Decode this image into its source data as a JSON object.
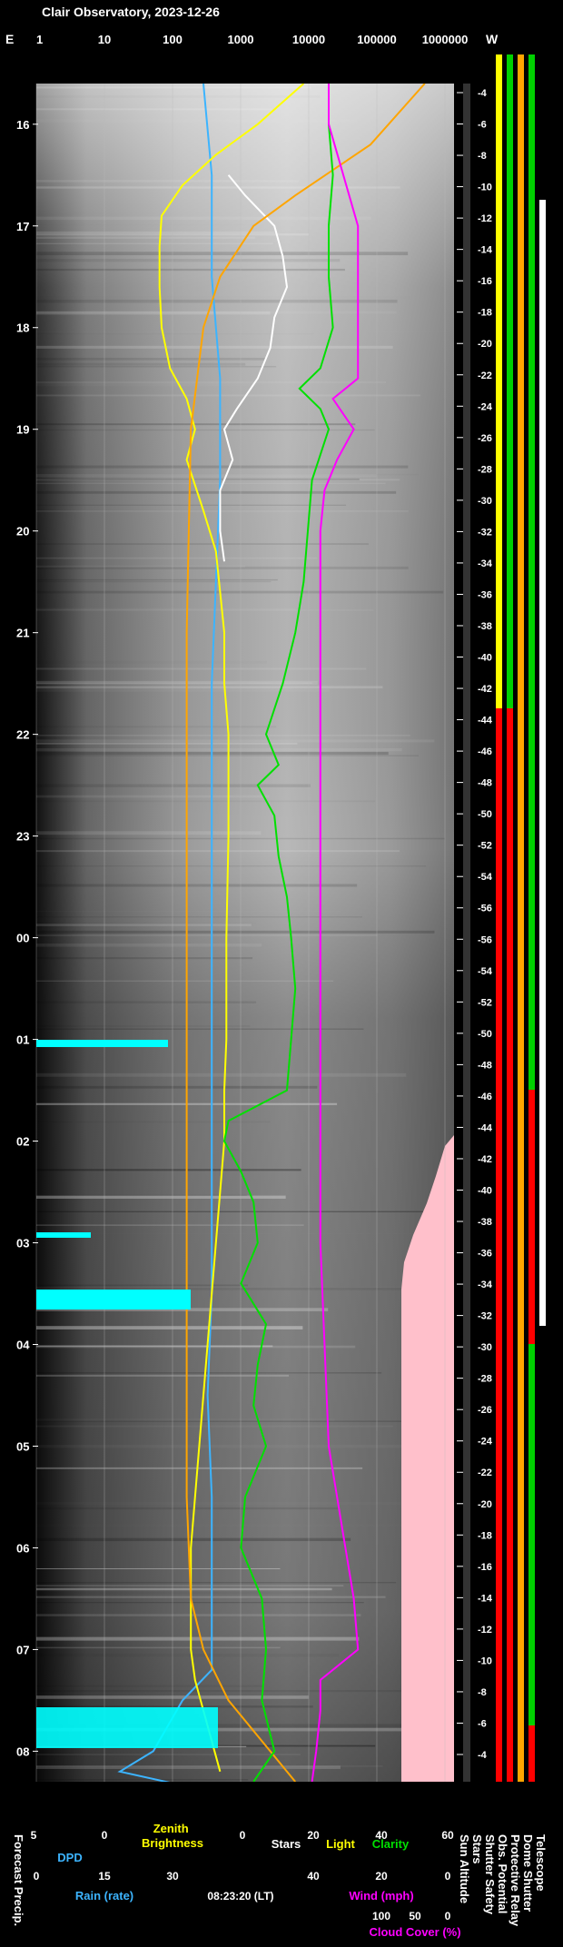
{
  "title": "Clair Observatory, 2023-12-26",
  "timestamp": "08:23:20 (LT)",
  "chart_data": {
    "type": "line",
    "title": "Clair Observatory, 2023-12-26",
    "top_axis": {
      "left_label": "E",
      "right_label": "W",
      "scale": "log",
      "ticks": [
        "1",
        "10",
        "100",
        "1000",
        "10000",
        "100000",
        "1000000"
      ]
    },
    "time_axis": {
      "labels": [
        "16",
        "17",
        "18",
        "19",
        "20",
        "21",
        "22",
        "23",
        "00",
        "01",
        "02",
        "03",
        "04",
        "05",
        "06",
        "07",
        "08"
      ]
    },
    "sun_altitude_labels": [
      "-4",
      "-6",
      "-8",
      "-10",
      "-12",
      "-14",
      "-16",
      "-18",
      "-20",
      "-22",
      "-24",
      "-26",
      "-28",
      "-30",
      "-32",
      "-34",
      "-36",
      "-38",
      "-40",
      "-42",
      "-44",
      "-46",
      "-48",
      "-50",
      "-52",
      "-54",
      "-56",
      "-56",
      "-54",
      "-52",
      "-50",
      "-48",
      "-46",
      "-44",
      "-42",
      "-40",
      "-38",
      "-36",
      "-34",
      "-32",
      "-30",
      "-28",
      "-26",
      "-24",
      "-22",
      "-20",
      "-18",
      "-16",
      "-14",
      "-12",
      "-10",
      "-8",
      "-6",
      "-4"
    ],
    "bottom_axes": {
      "dpd": {
        "label": "DPD",
        "ticks": [
          "5",
          "0"
        ]
      },
      "zenith": {
        "label": "Zenith Brightness",
        "ticks": [
          "0"
        ]
      },
      "stars": {
        "label": "Stars",
        "ticks": [
          "20"
        ]
      },
      "light": {
        "label": "Light",
        "ticks": []
      },
      "clarity": {
        "label": "Clarity",
        "ticks": [
          "40",
          "60"
        ]
      },
      "rain": {
        "label": "Rain (rate)",
        "ticks": [
          "0",
          "15",
          "30"
        ]
      },
      "wind": {
        "label": "Wind (mph)",
        "ticks": [
          "40",
          "20",
          "0"
        ]
      },
      "cloud": {
        "label": "Cloud Cover (%)",
        "ticks": [
          "100",
          "50",
          "0"
        ]
      }
    },
    "left_label": "Forecast Precip.",
    "right_column_labels": [
      "Sun Altitude",
      "Stars",
      "Shutter Safety",
      "Obs. Potential",
      "Protective Relay",
      "Dome Shutter",
      "Telescope"
    ],
    "series": [
      {
        "name": "DPD",
        "color": "#3cb4ff",
        "points": [
          [
            15.6,
            0.4
          ],
          [
            16.5,
            0.42
          ],
          [
            17.5,
            0.42
          ],
          [
            18.5,
            0.44
          ],
          [
            19.5,
            0.44
          ],
          [
            20.5,
            0.43
          ],
          [
            21.5,
            0.42
          ],
          [
            22.5,
            0.42
          ],
          [
            23.5,
            0.42
          ],
          [
            24.5,
            0.42
          ],
          [
            25.5,
            0.42
          ],
          [
            26.5,
            0.42
          ],
          [
            27.5,
            0.42
          ],
          [
            28.5,
            0.41
          ],
          [
            29.5,
            0.42
          ],
          [
            30.5,
            0.42
          ],
          [
            31.2,
            0.42
          ],
          [
            31.5,
            0.35
          ],
          [
            32.0,
            0.28
          ],
          [
            32.2,
            0.2
          ],
          [
            32.4,
            0.42
          ]
        ]
      },
      {
        "name": "Zenith Brightness",
        "color": "#ffff00",
        "points": [
          [
            15.6,
            0.64
          ],
          [
            16.0,
            0.53
          ],
          [
            16.3,
            0.43
          ],
          [
            16.6,
            0.35
          ],
          [
            16.9,
            0.3
          ],
          [
            17.2,
            0.295
          ],
          [
            17.6,
            0.295
          ],
          [
            18.0,
            0.3
          ],
          [
            18.4,
            0.32
          ],
          [
            18.7,
            0.36
          ],
          [
            19.0,
            0.38
          ],
          [
            19.3,
            0.36
          ],
          [
            19.8,
            0.4
          ],
          [
            20.2,
            0.43
          ],
          [
            20.6,
            0.44
          ],
          [
            21.0,
            0.45
          ],
          [
            21.5,
            0.45
          ],
          [
            22.0,
            0.46
          ],
          [
            22.5,
            0.46
          ],
          [
            23.0,
            0.46
          ],
          [
            24.0,
            0.455
          ],
          [
            25.0,
            0.455
          ],
          [
            25.5,
            0.45
          ],
          [
            26.0,
            0.45
          ],
          [
            26.5,
            0.44
          ],
          [
            27.0,
            0.43
          ],
          [
            27.5,
            0.42
          ],
          [
            28.0,
            0.41
          ],
          [
            28.5,
            0.4
          ],
          [
            29.0,
            0.39
          ],
          [
            29.5,
            0.38
          ],
          [
            30.0,
            0.37
          ],
          [
            30.5,
            0.37
          ],
          [
            31.0,
            0.37
          ],
          [
            31.3,
            0.38
          ],
          [
            31.6,
            0.4
          ],
          [
            31.9,
            0.42
          ],
          [
            32.2,
            0.44
          ]
        ]
      },
      {
        "name": "Stars",
        "color": "#ffffff",
        "points": [
          [
            16.5,
            0.46
          ],
          [
            16.7,
            0.5
          ],
          [
            17.0,
            0.57
          ],
          [
            17.3,
            0.59
          ],
          [
            17.6,
            0.6
          ],
          [
            17.9,
            0.57
          ],
          [
            18.2,
            0.56
          ],
          [
            18.5,
            0.53
          ],
          [
            18.8,
            0.48
          ],
          [
            19.0,
            0.45
          ],
          [
            19.3,
            0.47
          ],
          [
            19.6,
            0.44
          ],
          [
            20.0,
            0.44
          ],
          [
            20.3,
            0.45
          ]
        ]
      },
      {
        "name": "Light",
        "color": "#ffa500",
        "points": [
          [
            15.6,
            0.93
          ],
          [
            16.2,
            0.8
          ],
          [
            16.7,
            0.62
          ],
          [
            17.0,
            0.52
          ],
          [
            17.5,
            0.44
          ],
          [
            18.0,
            0.4
          ],
          [
            19.0,
            0.37
          ],
          [
            20.0,
            0.365
          ],
          [
            21.0,
            0.36
          ],
          [
            22.0,
            0.36
          ],
          [
            24.0,
            0.36
          ],
          [
            26.0,
            0.36
          ],
          [
            28.0,
            0.36
          ],
          [
            29.5,
            0.36
          ],
          [
            30.5,
            0.37
          ],
          [
            31.0,
            0.4
          ],
          [
            31.5,
            0.46
          ],
          [
            32.0,
            0.56
          ],
          [
            32.3,
            0.62
          ]
        ]
      },
      {
        "name": "Clarity",
        "color": "#00e000",
        "points": [
          [
            15.6,
            0.7
          ],
          [
            16.0,
            0.7
          ],
          [
            16.5,
            0.71
          ],
          [
            17.0,
            0.7
          ],
          [
            17.5,
            0.7
          ],
          [
            18.0,
            0.71
          ],
          [
            18.4,
            0.68
          ],
          [
            18.6,
            0.63
          ],
          [
            18.8,
            0.68
          ],
          [
            19.0,
            0.7
          ],
          [
            19.5,
            0.66
          ],
          [
            20.0,
            0.65
          ],
          [
            20.5,
            0.64
          ],
          [
            21.0,
            0.62
          ],
          [
            21.5,
            0.59
          ],
          [
            22.0,
            0.55
          ],
          [
            22.3,
            0.58
          ],
          [
            22.5,
            0.53
          ],
          [
            22.8,
            0.57
          ],
          [
            23.2,
            0.58
          ],
          [
            23.6,
            0.6
          ],
          [
            24.0,
            0.61
          ],
          [
            24.5,
            0.62
          ],
          [
            25.0,
            0.61
          ],
          [
            25.5,
            0.6
          ],
          [
            25.8,
            0.46
          ],
          [
            26.0,
            0.45
          ],
          [
            26.3,
            0.49
          ],
          [
            26.6,
            0.52
          ],
          [
            27.0,
            0.53
          ],
          [
            27.4,
            0.49
          ],
          [
            27.8,
            0.55
          ],
          [
            28.2,
            0.53
          ],
          [
            28.6,
            0.52
          ],
          [
            29.0,
            0.55
          ],
          [
            29.5,
            0.5
          ],
          [
            30.0,
            0.49
          ],
          [
            30.5,
            0.54
          ],
          [
            31.0,
            0.55
          ],
          [
            31.5,
            0.54
          ],
          [
            32.0,
            0.57
          ],
          [
            32.3,
            0.52
          ]
        ]
      },
      {
        "name": "Cloud Cover",
        "color": "#ff00ff",
        "points": [
          [
            15.6,
            0.7
          ],
          [
            16.0,
            0.7
          ],
          [
            17.0,
            0.77
          ],
          [
            18.0,
            0.77
          ],
          [
            18.5,
            0.77
          ],
          [
            18.7,
            0.71
          ],
          [
            19.0,
            0.76
          ],
          [
            19.3,
            0.72
          ],
          [
            19.6,
            0.69
          ],
          [
            20.0,
            0.68
          ],
          [
            21.0,
            0.68
          ],
          [
            22.0,
            0.68
          ],
          [
            23.0,
            0.68
          ],
          [
            24.0,
            0.68
          ],
          [
            25.0,
            0.68
          ],
          [
            26.0,
            0.68
          ],
          [
            27.0,
            0.68
          ],
          [
            28.0,
            0.69
          ],
          [
            29.0,
            0.7
          ],
          [
            29.5,
            0.72
          ],
          [
            30.0,
            0.74
          ],
          [
            30.5,
            0.76
          ],
          [
            31.0,
            0.77
          ],
          [
            31.3,
            0.68
          ],
          [
            31.6,
            0.68
          ],
          [
            32.0,
            0.67
          ],
          [
            32.3,
            0.66
          ]
        ]
      }
    ]
  }
}
